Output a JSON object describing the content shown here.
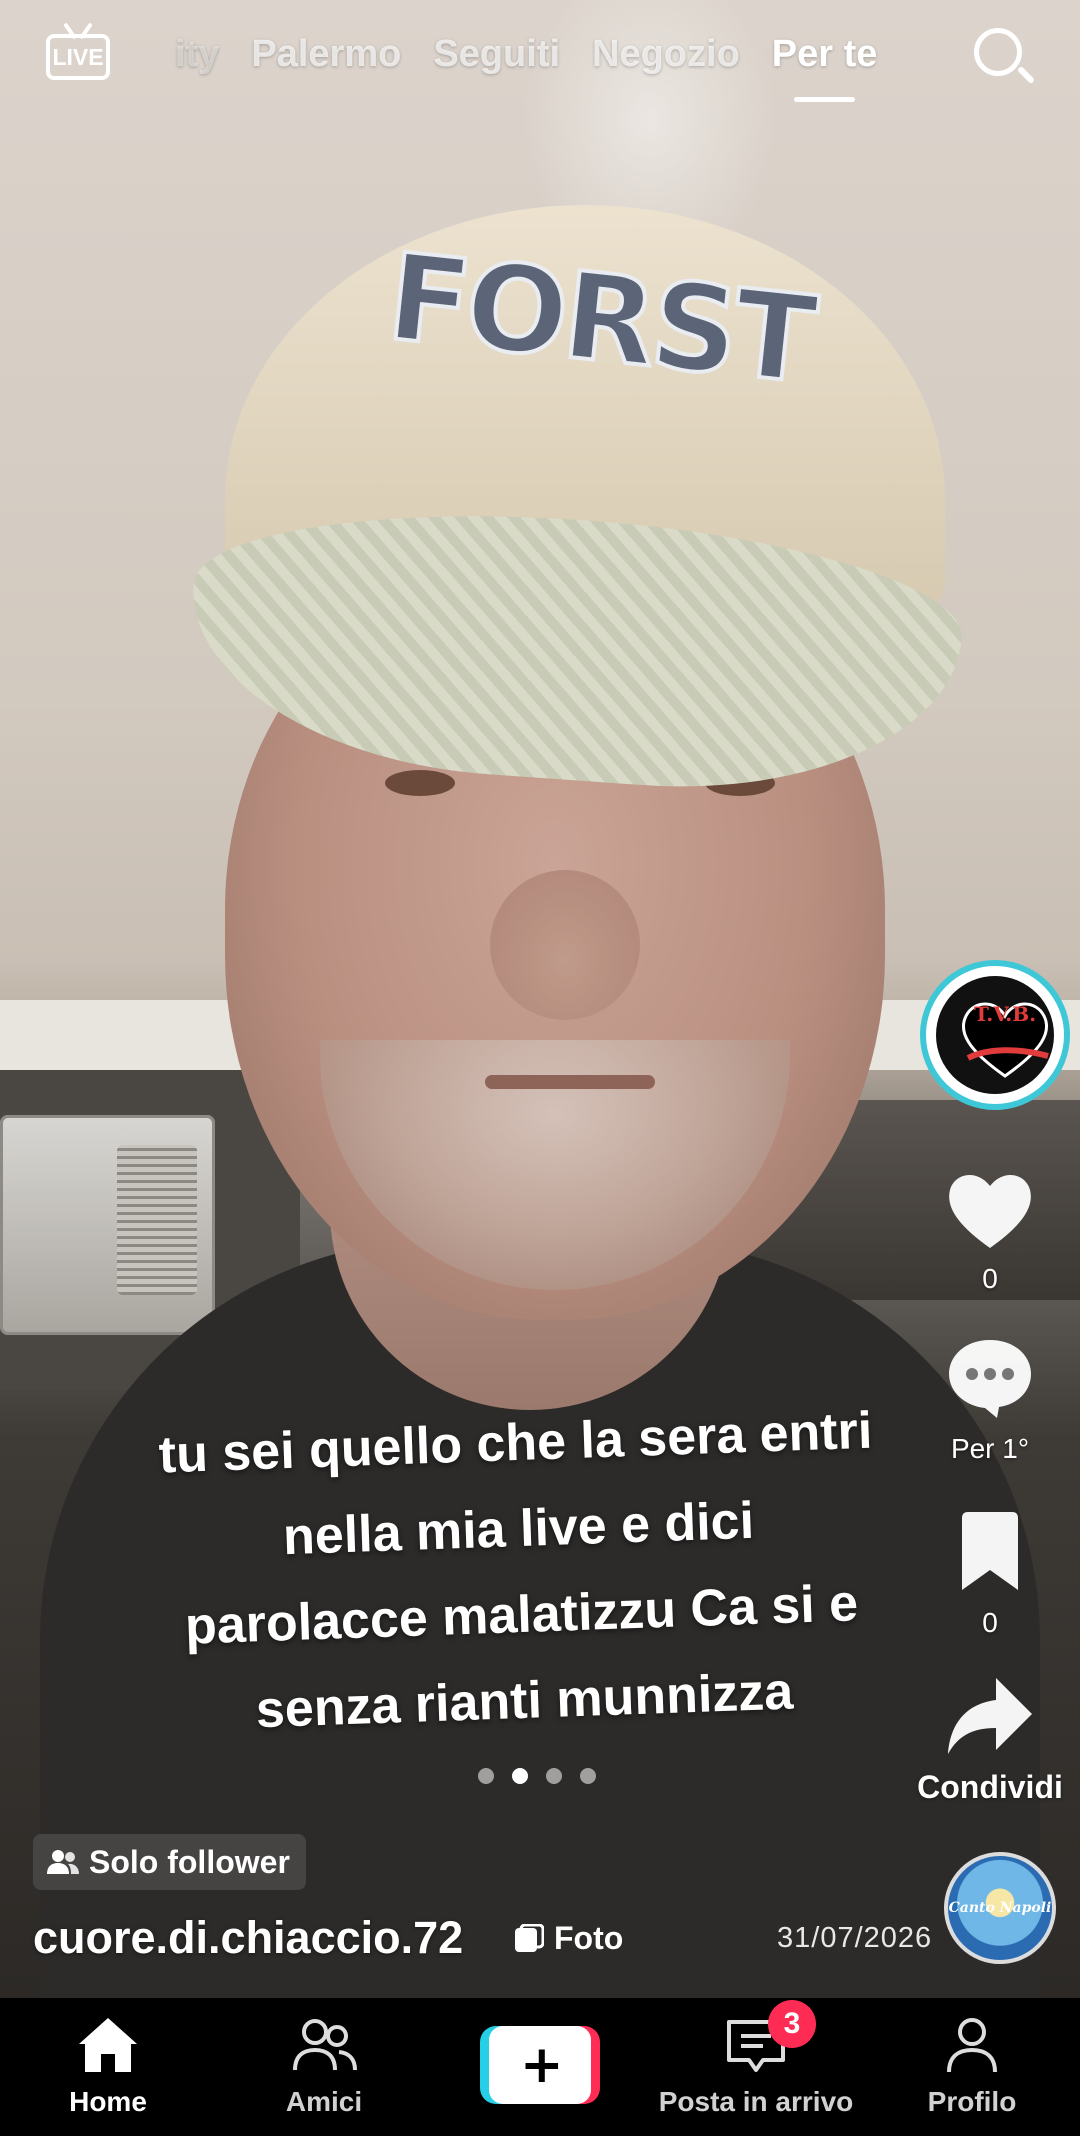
{
  "top_bar": {
    "live_label": "LIVE",
    "tabs": [
      {
        "label": "ity",
        "state": "faded"
      },
      {
        "label": "Palermo",
        "state": "inactive"
      },
      {
        "label": "Seguiti",
        "state": "inactive"
      },
      {
        "label": "Negozio",
        "state": "inactive"
      },
      {
        "label": "Per te",
        "state": "active"
      }
    ]
  },
  "caption": {
    "lines": [
      "tu sei quello che la sera entri",
      "nella mia live e dici",
      "parolacce malatizzu Ca si e",
      "senza rianti munnizza"
    ]
  },
  "carousel": {
    "total_dots": 4,
    "active_index": 1
  },
  "actions": {
    "creator_avatar_text": "T.V.B.",
    "like_count": "0",
    "comment_label": "Per 1°",
    "save_count": "0",
    "share_label": "Condividi"
  },
  "post_info": {
    "follower_badge": "Solo follower",
    "username": "cuore.di.chiaccio.72",
    "type_label": "Foto",
    "date": "31/07/2026",
    "date_tail": "6",
    "music_disc_text": "Canto Napoli"
  },
  "bottom_nav": {
    "items": [
      {
        "label": "Home",
        "icon": "home-icon",
        "active": true
      },
      {
        "label": "Amici",
        "icon": "friends-icon",
        "active": false
      },
      {
        "label": "",
        "icon": "create-plus-icon",
        "active": false
      },
      {
        "label": "Posta in arrivo",
        "icon": "inbox-icon",
        "active": false
      },
      {
        "label": "Profilo",
        "icon": "profile-icon",
        "active": false
      }
    ],
    "inbox_badge": "3"
  },
  "colors": {
    "accent_red": "#fe2c55",
    "accent_cyan": "#25d0e6",
    "avatar_ring": "#3ec7d6"
  }
}
